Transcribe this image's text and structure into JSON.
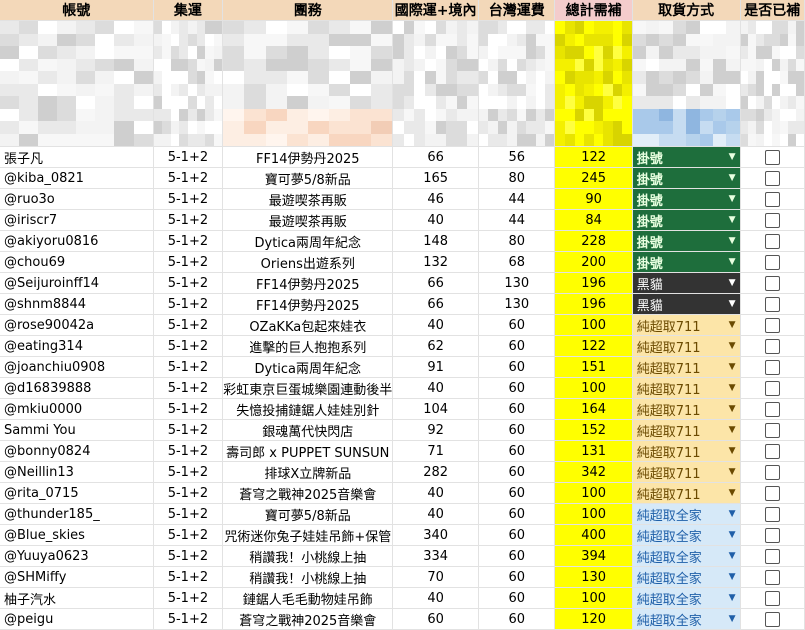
{
  "headers": [
    "帳號",
    "集運",
    "團務",
    "國際運+境內",
    "台灣運費",
    "總計需補",
    "取貨方式",
    "是否已補"
  ],
  "rows": [
    {
      "user": "張子凡",
      "ship": "5-1+2",
      "group": "FF14伊勢丹2025",
      "intl": "66",
      "tw": "56",
      "total": "122",
      "pickup": "掛號",
      "style": "green"
    },
    {
      "user": "@kiba_0821",
      "ship": "5-1+2",
      "group": "寶可夢5/8新品",
      "intl": "165",
      "tw": "80",
      "total": "245",
      "pickup": "掛號",
      "style": "green"
    },
    {
      "user": "@ruo3o",
      "ship": "5-1+2",
      "group": "最遊喫茶再販",
      "intl": "46",
      "tw": "44",
      "total": "90",
      "pickup": "掛號",
      "style": "green"
    },
    {
      "user": "@iriscr7",
      "ship": "5-1+2",
      "group": "最遊喫茶再販",
      "intl": "40",
      "tw": "44",
      "total": "84",
      "pickup": "掛號",
      "style": "green"
    },
    {
      "user": "@akiyoru0816",
      "ship": "5-1+2",
      "group": "Dytica兩周年紀念",
      "intl": "148",
      "tw": "80",
      "total": "228",
      "pickup": "掛號",
      "style": "green"
    },
    {
      "user": "@chou69",
      "ship": "5-1+2",
      "group": "Oriens出遊系列",
      "intl": "132",
      "tw": "68",
      "total": "200",
      "pickup": "掛號",
      "style": "green"
    },
    {
      "user": "@Seijuroinff14",
      "ship": "5-1+2",
      "group": "FF14伊勢丹2025",
      "intl": "66",
      "tw": "130",
      "total": "196",
      "pickup": "黑貓",
      "style": "black"
    },
    {
      "user": "@shnm8844",
      "ship": "5-1+2",
      "group": "FF14伊勢丹2025",
      "intl": "66",
      "tw": "130",
      "total": "196",
      "pickup": "黑貓",
      "style": "black"
    },
    {
      "user": "@rose90042a",
      "ship": "5-1+2",
      "group": "OZaKKa包起來娃衣",
      "intl": "40",
      "tw": "60",
      "total": "100",
      "pickup": "純超取711",
      "style": "orange"
    },
    {
      "user": "@eating314",
      "ship": "5-1+2",
      "group": "進擊的巨人抱抱系列",
      "intl": "62",
      "tw": "60",
      "total": "122",
      "pickup": "純超取711",
      "style": "orange"
    },
    {
      "user": "@joanchiu0908",
      "ship": "5-1+2",
      "group": "Dytica兩周年紀念",
      "intl": "91",
      "tw": "60",
      "total": "151",
      "pickup": "純超取711",
      "style": "orange"
    },
    {
      "user": "@d16839888",
      "ship": "5-1+2",
      "group": "彩虹東京巨蛋城樂園連動後半",
      "intl": "40",
      "tw": "60",
      "total": "100",
      "pickup": "純超取711",
      "style": "orange"
    },
    {
      "user": "@mkiu0000",
      "ship": "5-1+2",
      "group": "失憶投捕鏈鋸人娃娃別針",
      "intl": "104",
      "tw": "60",
      "total": "164",
      "pickup": "純超取711",
      "style": "orange"
    },
    {
      "user": "Sammi You",
      "ship": "5-1+2",
      "group": "銀魂萬代快閃店",
      "intl": "92",
      "tw": "60",
      "total": "152",
      "pickup": "純超取711",
      "style": "orange"
    },
    {
      "user": "@bonny0824",
      "ship": "5-1+2",
      "group": "壽司郎 x PUPPET SUNSUN",
      "intl": "71",
      "tw": "60",
      "total": "131",
      "pickup": "純超取711",
      "style": "orange"
    },
    {
      "user": "@Neillin13",
      "ship": "5-1+2",
      "group": "排球X立牌新品",
      "intl": "282",
      "tw": "60",
      "total": "342",
      "pickup": "純超取711",
      "style": "orange"
    },
    {
      "user": "@rita_0715",
      "ship": "5-1+2",
      "group": "蒼穹之戰神2025音樂會",
      "intl": "40",
      "tw": "60",
      "total": "100",
      "pickup": "純超取711",
      "style": "orange"
    },
    {
      "user": "@thunder185_",
      "ship": "5-1+2",
      "group": "寶可夢5/8新品",
      "intl": "40",
      "tw": "60",
      "total": "100",
      "pickup": "純超取全家",
      "style": "blue"
    },
    {
      "user": "@Blue_skies",
      "ship": "5-1+2",
      "group": "咒術迷你兔子娃娃吊飾+保管",
      "intl": "340",
      "tw": "60",
      "total": "400",
      "pickup": "純超取全家",
      "style": "blue"
    },
    {
      "user": "@Yuuya0623",
      "ship": "5-1+2",
      "group": "稍讚我！小桃線上抽",
      "intl": "334",
      "tw": "60",
      "total": "394",
      "pickup": "純超取全家",
      "style": "blue"
    },
    {
      "user": "@SHMiffy",
      "ship": "5-1+2",
      "group": "稍讚我！小桃線上抽",
      "intl": "70",
      "tw": "60",
      "total": "130",
      "pickup": "純超取全家",
      "style": "blue"
    },
    {
      "user": "柚子汽水",
      "ship": "5-1+2",
      "group": "鏈鋸人毛毛動物娃吊飾",
      "intl": "40",
      "tw": "60",
      "total": "100",
      "pickup": "純超取全家",
      "style": "blue"
    },
    {
      "user": "@peigu",
      "ship": "5-1+2",
      "group": "蒼穹之戰神2025音樂會",
      "intl": "60",
      "tw": "60",
      "total": "120",
      "pickup": "純超取全家",
      "style": "blue"
    }
  ],
  "icons": {
    "dropdown": "dropdown-arrow-icon",
    "checkbox": "checkbox-icon"
  }
}
